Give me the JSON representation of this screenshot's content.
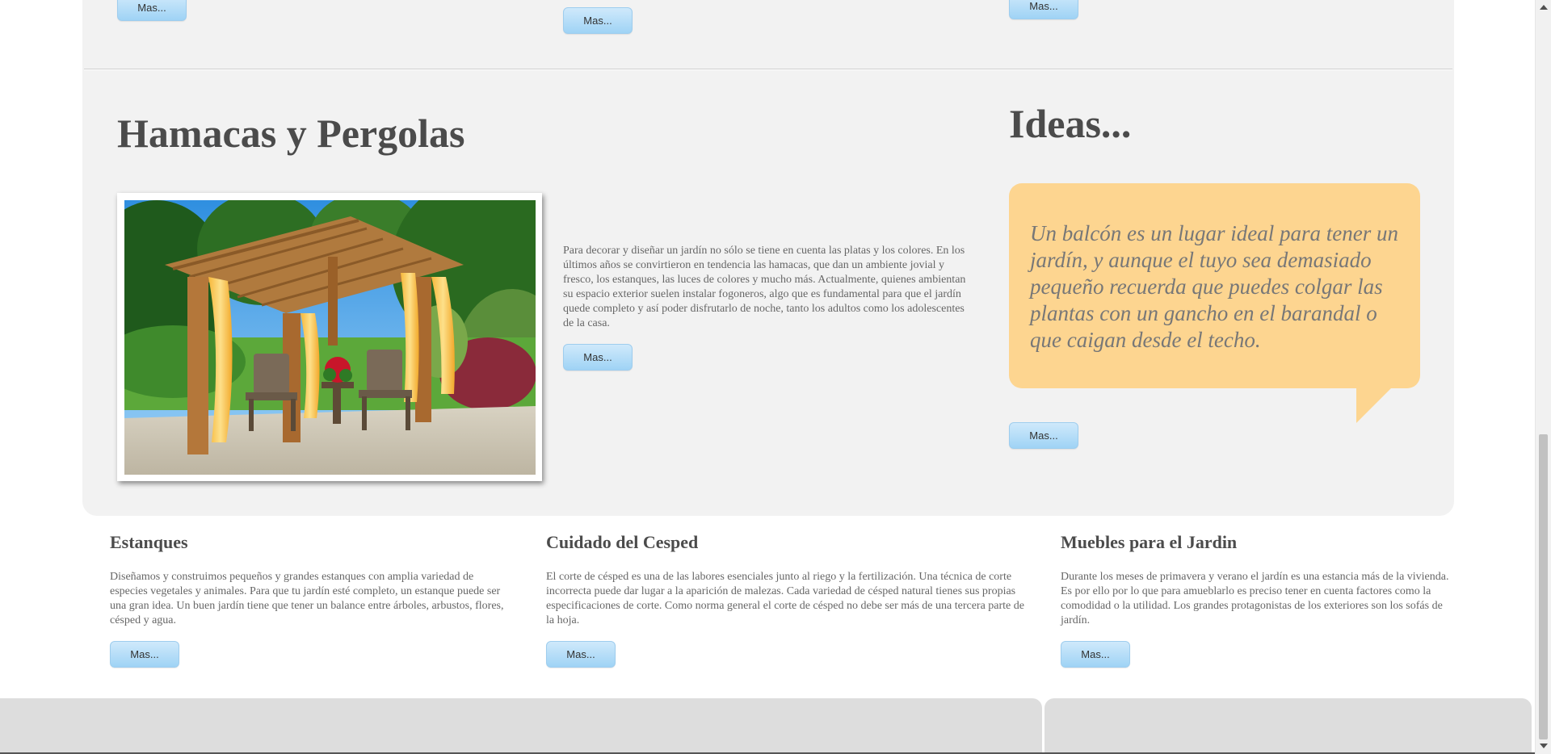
{
  "top_buttons": [
    "Mas...",
    "Mas...",
    "Mas..."
  ],
  "hamacas": {
    "title": "Hamacas y Pergolas",
    "body": "Para decorar y diseñar un jardín no sólo se tiene en cuenta las platas y los colores. En los últimos años se convirtieron en tendencia las hamacas, que dan un ambiente jovial y fresco, los estanques, las luces de colores y mucho más. Actualmente, quienes ambientan su espacio exterior suelen instalar fogoneros, algo que es fundamental para que el jardín quede completo y así poder disfrutarlo de noche, tanto los adultos como los adolescentes de la casa.",
    "button": "Mas..."
  },
  "ideas": {
    "title": "Ideas...",
    "quote": "Un balcón es un lugar ideal para tener un jardín, y aunque el tuyo sea demasiado pequeño recuerda que puedes colgar las plantas con un gancho en el barandal o que caigan desde el techo.",
    "button": "Mas..."
  },
  "sections": [
    {
      "title": "Estanques",
      "body": "Diseñamos y construimos pequeños y grandes estanques con amplia variedad de especies vegetales y animales. Para que tu jardín esté completo, un estanque puede ser una gran idea. Un buen jardín tiene que tener un balance entre árboles, arbustos, flores, césped y agua.",
      "button": "Mas..."
    },
    {
      "title": "Cuidado del Cesped",
      "body": "El corte de césped es una de las labores esenciales junto al riego y la fertilización. Una técnica de corte incorrecta puede dar lugar a la aparición de malezas. Cada variedad de césped natural tienes sus propias especificaciones de corte. Como norma general el corte de césped no debe ser más de una tercera parte de la hoja.",
      "button": "Mas..."
    },
    {
      "title": "Muebles para el Jardin",
      "body": "Durante los meses de primavera y verano el jardín es una estancia más de la vivienda. Es por ello por lo que para amueblarlo es preciso tener en cuenta factores como la comodidad o la utilidad. Los grandes protagonistas de los exteriores son los sofás de jardín.",
      "button": "Mas..."
    }
  ],
  "colors": {
    "panel": "#f2f2f2",
    "button": "#b7def8",
    "quote_bubble": "#fdd590",
    "footer": "#dddddd"
  }
}
